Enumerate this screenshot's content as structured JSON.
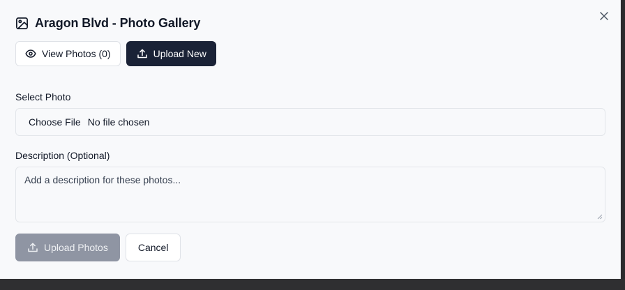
{
  "dialog": {
    "title": "Aragon Blvd - Photo Gallery",
    "title_icon": "image-icon",
    "close_icon": "close-icon"
  },
  "tabs": {
    "view": {
      "label": "View Photos (0)",
      "icon": "eye-icon"
    },
    "upload": {
      "label": "Upload New",
      "icon": "upload-icon",
      "active": true
    }
  },
  "form": {
    "select_photo_label": "Select Photo",
    "choose_file_label": "Choose File",
    "file_status": "No file chosen",
    "description_label": "Description (Optional)",
    "description_placeholder": "Add a description for these photos...",
    "description_value": ""
  },
  "actions": {
    "upload_label": "Upload Photos",
    "upload_icon": "upload-icon",
    "upload_disabled": true,
    "cancel_label": "Cancel"
  },
  "colors": {
    "dialog_bg": "#f8f9fb",
    "primary_dark": "#1a2236",
    "disabled_button": "#8f95a3",
    "border": "#dfe2e7"
  }
}
